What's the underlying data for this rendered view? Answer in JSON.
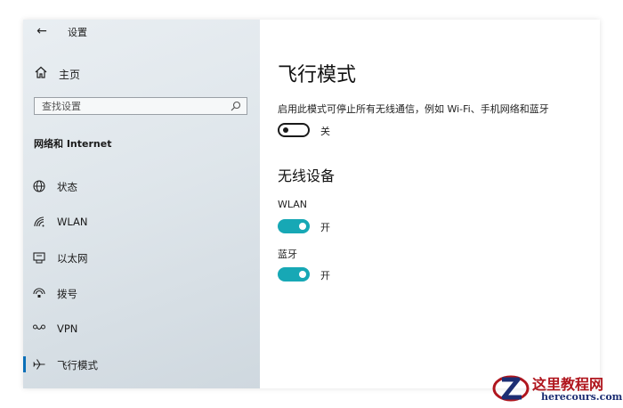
{
  "window": {
    "title": "设置",
    "back_icon": "arrow-left-icon"
  },
  "sidebar": {
    "home_label": "主页",
    "search_placeholder": "查找设置",
    "section_title": "网络和 Internet",
    "items": [
      {
        "label": "状态",
        "icon": "globe-icon",
        "active": false
      },
      {
        "label": "WLAN",
        "icon": "wifi-icon",
        "active": false
      },
      {
        "label": "以太网",
        "icon": "ethernet-icon",
        "active": false
      },
      {
        "label": "拨号",
        "icon": "dialup-icon",
        "active": false
      },
      {
        "label": "VPN",
        "icon": "vpn-icon",
        "active": false
      },
      {
        "label": "飞行模式",
        "icon": "airplane-icon",
        "active": true
      }
    ]
  },
  "main": {
    "title": "飞行模式",
    "description": "启用此模式可停止所有无线通信，例如 Wi-Fi、手机网络和蓝牙",
    "airplane_toggle": {
      "on": false,
      "state_label": "关"
    },
    "wireless_heading": "无线设备",
    "devices": [
      {
        "label": "WLAN",
        "on": true,
        "state_label": "开"
      },
      {
        "label": "蓝牙",
        "on": true,
        "state_label": "开"
      }
    ]
  },
  "colors": {
    "accent": "#0a6fb8",
    "toggle_on": "#17a8b5",
    "watermark_red": "#b0161e",
    "watermark_blue": "#1d2e73"
  },
  "watermark": {
    "title": "这里教程网",
    "url": "herecours.com"
  }
}
